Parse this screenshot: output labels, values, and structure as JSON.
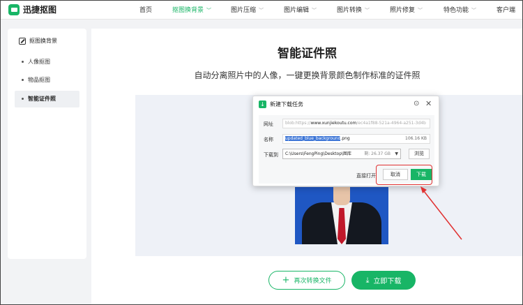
{
  "app": {
    "name": "迅捷抠图"
  },
  "nav": {
    "items": [
      {
        "label": "首页",
        "dropdown": false
      },
      {
        "label": "抠图换背景",
        "dropdown": true,
        "active": true
      },
      {
        "label": "图片压缩",
        "dropdown": true
      },
      {
        "label": "图片编辑",
        "dropdown": true
      },
      {
        "label": "图片转换",
        "dropdown": true
      },
      {
        "label": "照片修复",
        "dropdown": true
      },
      {
        "label": "特色功能",
        "dropdown": true
      },
      {
        "label": "客户端",
        "dropdown": false
      }
    ]
  },
  "sidebar": {
    "title": "抠图换背景",
    "items": [
      {
        "label": "人像抠图"
      },
      {
        "label": "物品抠图"
      },
      {
        "label": "智能证件照",
        "active": true
      }
    ]
  },
  "main": {
    "title": "智能证件照",
    "subtitle": "自动分离照片中的人像，一键更换背景颜色制作标准的证件照",
    "again_label": "再次转换文件",
    "download_label": "立即下载"
  },
  "dialog": {
    "title": "新建下载任务",
    "url_label": "网址",
    "url_prefix": "blob:https://",
    "url_host": "www.xunjiekoutu.com",
    "url_rest": "/ec4a1f88-521a-4964-a251-3d4b",
    "name_label": "名称",
    "filename_selected": "updated_blue_background",
    "filename_ext": ".png",
    "file_size": "106.16 KB",
    "saveto_label": "下载到",
    "path": "C:\\Users\\FengPing\\Desktop\\图库",
    "free_space": "剩: 26.37 GB",
    "browse_label": "浏览",
    "open_direct_label": "直接打开",
    "cancel_label": "取消",
    "confirm_label": "下载"
  },
  "colors": {
    "accent": "#18b566",
    "annotation": "#e03131",
    "photo_bg": "#1f57c3"
  }
}
